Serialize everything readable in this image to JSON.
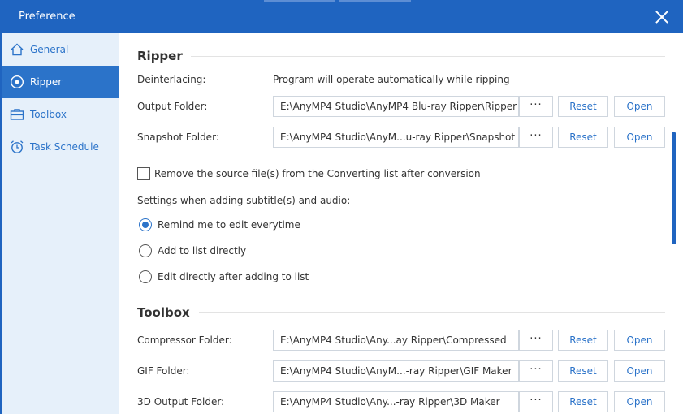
{
  "window": {
    "title": "Preference"
  },
  "sidebar": {
    "items": [
      {
        "label": "General",
        "icon": "home-icon",
        "active": false
      },
      {
        "label": "Ripper",
        "icon": "disc-icon",
        "active": true
      },
      {
        "label": "Toolbox",
        "icon": "toolbox-icon",
        "active": false
      },
      {
        "label": "Task Schedule",
        "icon": "alarm-clock-icon",
        "active": false
      }
    ]
  },
  "ripper": {
    "title": "Ripper",
    "deinterlacing": {
      "label": "Deinterlacing:",
      "value": "Program will operate automatically while ripping"
    },
    "output_folder": {
      "label": "Output Folder:",
      "path": "E:\\AnyMP4 Studio\\AnyMP4 Blu-ray Ripper\\Ripper"
    },
    "snapshot_folder": {
      "label": "Snapshot Folder:",
      "path": "E:\\AnyMP4 Studio\\AnyM...u-ray Ripper\\Snapshot"
    },
    "remove_source": {
      "label": "Remove the source file(s) from the Converting list after conversion",
      "checked": false
    },
    "subtitle_settings": {
      "label": "Settings when adding subtitle(s) and audio:",
      "options": [
        {
          "label": "Remind me to edit everytime",
          "selected": true
        },
        {
          "label": "Add to list directly",
          "selected": false
        },
        {
          "label": "Edit directly after adding to list",
          "selected": false
        }
      ]
    }
  },
  "toolbox": {
    "title": "Toolbox",
    "compressor_folder": {
      "label": "Compressor Folder:",
      "path": "E:\\AnyMP4 Studio\\Any...ay Ripper\\Compressed"
    },
    "gif_folder": {
      "label": "GIF Folder:",
      "path": "E:\\AnyMP4 Studio\\AnyM...-ray Ripper\\GIF Maker"
    },
    "output_3d_folder": {
      "label": "3D Output Folder:",
      "path": "E:\\AnyMP4 Studio\\Any...-ray Ripper\\3D Maker"
    }
  },
  "buttons": {
    "browse": "···",
    "reset": "Reset",
    "open": "Open"
  },
  "colors": {
    "titlebar": "#1f64c0",
    "accent": "#2b73c9",
    "sidebar_bg": "#e6f0fa"
  }
}
